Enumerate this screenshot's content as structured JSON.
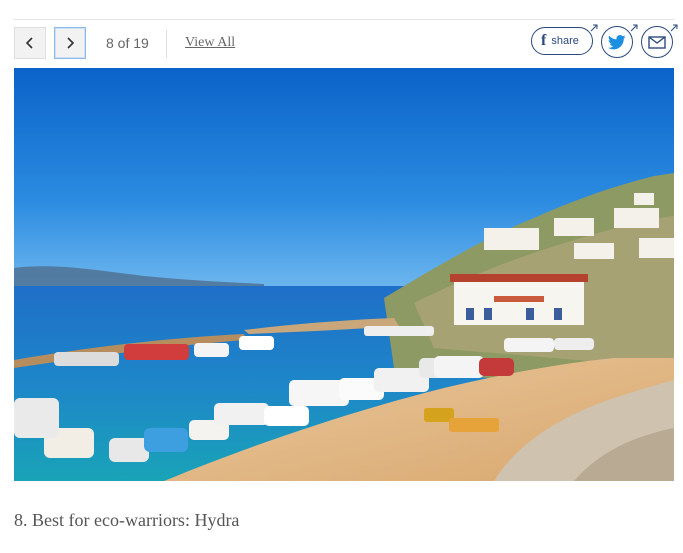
{
  "gallery": {
    "current": 8,
    "total": 19,
    "counter_text": "8 of 19",
    "view_all_label": "View All",
    "prev_icon": "chevron-left-icon",
    "next_icon": "chevron-right-icon"
  },
  "share": {
    "facebook_label": "share",
    "facebook_glyph": "f",
    "twitter_icon": "twitter-icon",
    "email_icon": "email-icon",
    "accent_color": "#2a4a7f"
  },
  "slide": {
    "image_subject": "Hydra harbour with boats and hillside houses",
    "caption": "8. Best for eco-warriors: Hydra"
  }
}
